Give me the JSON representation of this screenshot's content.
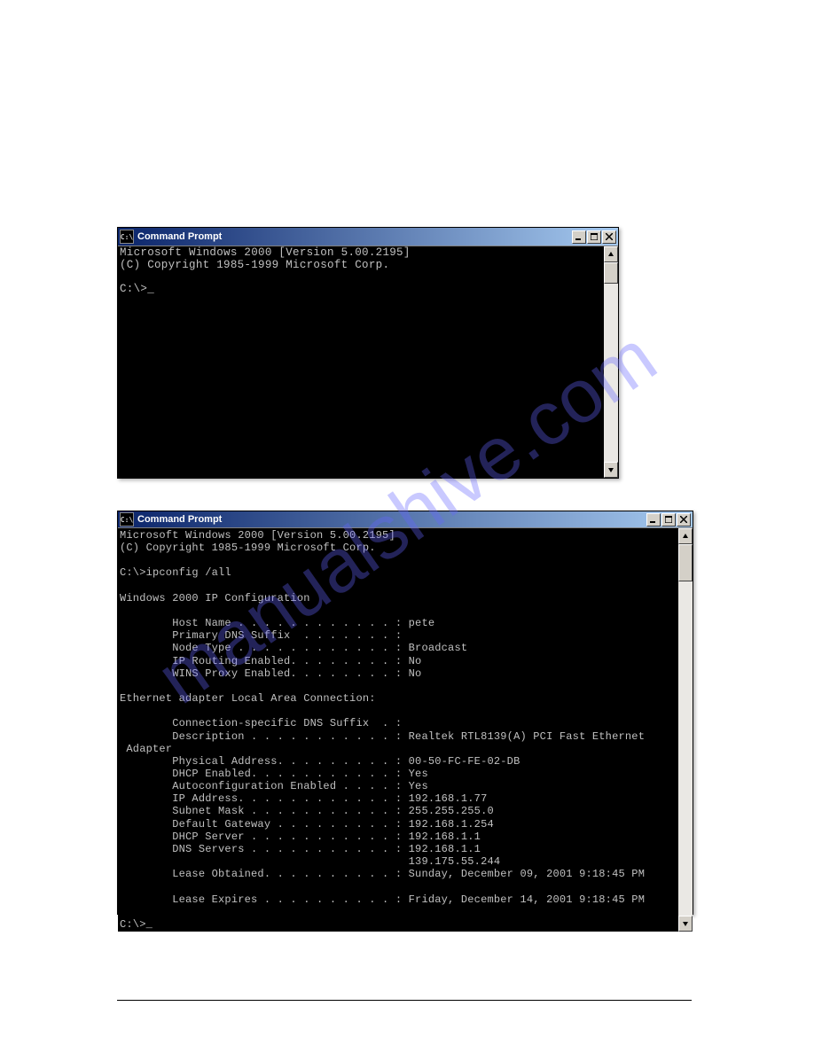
{
  "watermark": "manualshive.com",
  "window1": {
    "title": "Command Prompt",
    "content": "Microsoft Windows 2000 [Version 5.00.2195]\n(C) Copyright 1985-1999 Microsoft Corp.\n\nC:\\>_"
  },
  "window2": {
    "title": "Command Prompt",
    "content": "Microsoft Windows 2000 [Version 5.00.2195]\n(C) Copyright 1985-1999 Microsoft Corp.\n\nC:\\>ipconfig /all\n\nWindows 2000 IP Configuration\n\n        Host Name . . . . . . . . . . . . : pete\n        Primary DNS Suffix  . . . . . . . :\n        Node Type . . . . . . . . . . . . : Broadcast\n        IP Routing Enabled. . . . . . . . : No\n        WINS Proxy Enabled. . . . . . . . : No\n\nEthernet adapter Local Area Connection:\n\n        Connection-specific DNS Suffix  . :\n        Description . . . . . . . . . . . : Realtek RTL8139(A) PCI Fast Ethernet\n Adapter\n        Physical Address. . . . . . . . . : 00-50-FC-FE-02-DB\n        DHCP Enabled. . . . . . . . . . . : Yes\n        Autoconfiguration Enabled . . . . : Yes\n        IP Address. . . . . . . . . . . . : 192.168.1.77\n        Subnet Mask . . . . . . . . . . . : 255.255.255.0\n        Default Gateway . . . . . . . . . : 192.168.1.254\n        DHCP Server . . . . . . . . . . . : 192.168.1.1\n        DNS Servers . . . . . . . . . . . : 192.168.1.1\n                                            139.175.55.244\n        Lease Obtained. . . . . . . . . . : Sunday, December 09, 2001 9:18:45 PM\n\n        Lease Expires . . . . . . . . . . : Friday, December 14, 2001 9:18:45 PM\n\nC:\\>_"
  }
}
